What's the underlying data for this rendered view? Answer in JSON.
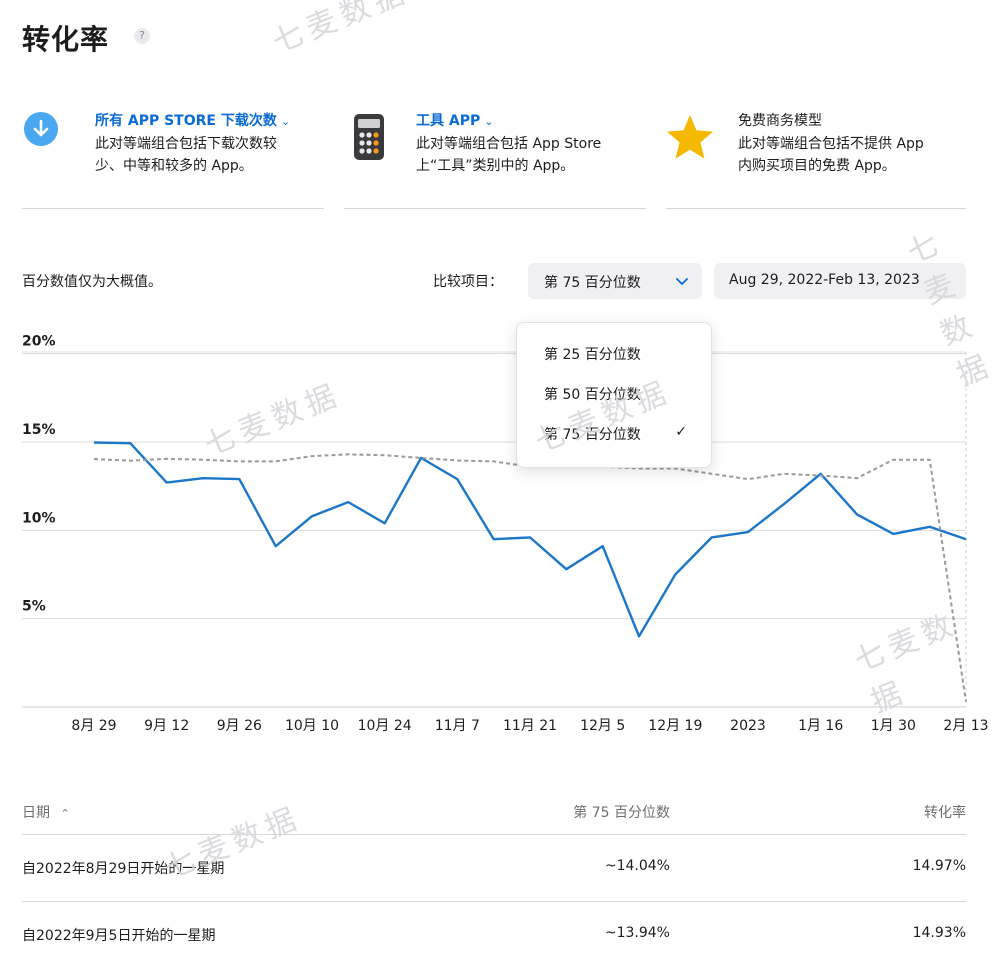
{
  "page": {
    "title": "转化率",
    "help": "?"
  },
  "filters": [
    {
      "title": "所有 APP STORE 下载次数",
      "chevron": "⌄",
      "desc1": "此对等端组合包括下载次数较",
      "desc2": "少、中等和较多的 App。",
      "icon": "download-circle-icon"
    },
    {
      "title": "工具 APP",
      "chevron": "⌄",
      "desc1": "此对等端组合包括 App Store",
      "desc2": "上“工具”类别中的 App。",
      "icon": "calculator-icon"
    },
    {
      "title": "免费商务模型",
      "desc1": "此对等端组合包括不提供 App",
      "desc2": "内购买项目的免费 App。",
      "icon": "star-icon"
    }
  ],
  "controls": {
    "note": "百分数值仅为大概值。",
    "compare_label": "比较项目：",
    "selected": "第 75 百分位数",
    "date_range": "Aug 29, 2022-Feb 13, 2023",
    "dropdown_items": [
      "第 25 百分位数",
      "第 50 百分位数",
      "第 75 百分位数"
    ],
    "check": "✓"
  },
  "chart_data": {
    "type": "line",
    "x": [
      "8月 29",
      "9月 5",
      "9月 12",
      "9月 19",
      "9月 26",
      "10月 3",
      "10月 10",
      "10月 17",
      "10月 24",
      "10月 31",
      "11月 7",
      "11月 14",
      "11月 21",
      "11月 28",
      "12月 5",
      "12月 12",
      "12月 19",
      "12月 26",
      "2023",
      "1月 9",
      "1月 16",
      "1月 23",
      "1月 30",
      "2月 6",
      "2月 13"
    ],
    "xticks": [
      "8月 29",
      "9月 12",
      "9月 26",
      "10月 10",
      "10月 24",
      "11月 7",
      "11月 21",
      "12月 5",
      "12月 19",
      "2023",
      "1月 16",
      "1月 30",
      "2月 13"
    ],
    "yticks": [
      "20%",
      "15%",
      "10%",
      "5%"
    ],
    "ylim": [
      0,
      21
    ],
    "series": [
      {
        "values": [
          14.97,
          14.93,
          12.7,
          12.95,
          12.9,
          9.1,
          10.8,
          11.6,
          10.4,
          14.1,
          12.9,
          9.5,
          9.6,
          7.8,
          9.1,
          4.0,
          7.5,
          9.6,
          9.9,
          11.5,
          13.2,
          10.9,
          9.8,
          10.2,
          9.5
        ],
        "color": "#1c77c9",
        "style": "solid"
      },
      {
        "values": [
          14.04,
          13.94,
          14.05,
          14.0,
          13.9,
          13.9,
          14.2,
          14.3,
          14.25,
          14.1,
          13.95,
          13.9,
          13.6,
          13.7,
          13.6,
          13.5,
          13.5,
          13.2,
          12.9,
          13.2,
          13.1,
          12.95,
          14.0,
          14.0,
          0.3
        ],
        "color": "#999999",
        "style": "dashed"
      }
    ]
  },
  "table": {
    "headers": [
      "日期",
      "第 75 百分位数",
      "转化率"
    ],
    "sort_icon": "⌃",
    "rows": [
      [
        "自2022年8月29日开始的一星期",
        "~14.04%",
        "14.97%"
      ],
      [
        "自2022年9月5日开始的一星期",
        "~13.94%",
        "14.93%"
      ]
    ]
  },
  "watermark": "七麦数据"
}
